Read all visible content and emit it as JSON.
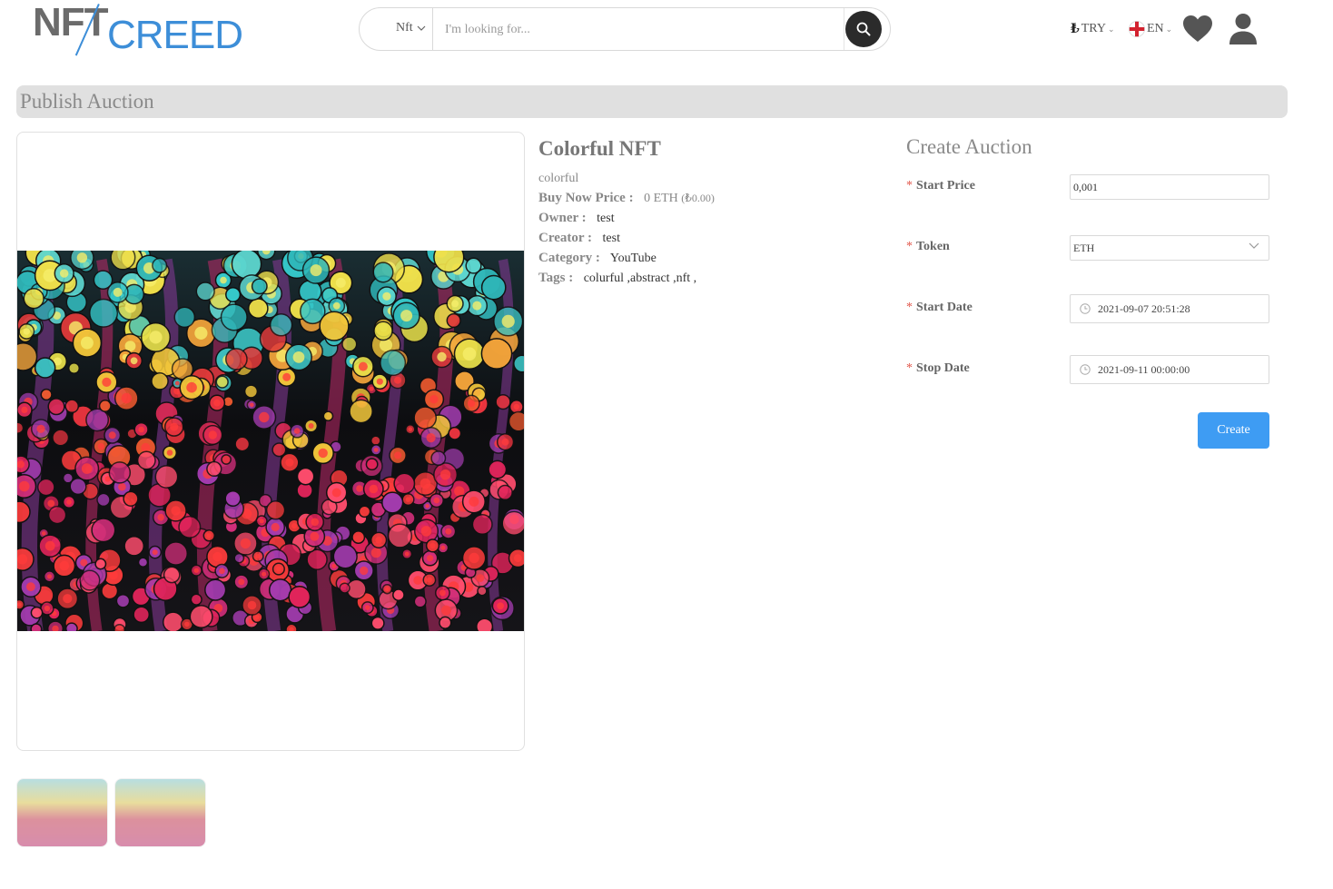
{
  "header": {
    "logo_part1": "NFT",
    "logo_part2": "CREED",
    "search": {
      "category": "Nft",
      "placeholder": "I'm looking for..."
    },
    "currency": "TRY",
    "currency_symbol": "₺",
    "language": "EN"
  },
  "page": {
    "title": "Publish Auction"
  },
  "nft": {
    "title": "Colorful NFT",
    "description": "colorful",
    "buy_now_label": "Buy Now Price :",
    "buy_now_value": "0 ETH",
    "buy_now_converted": "(₺0.00)",
    "owner_label": "Owner :",
    "owner_value": "test",
    "creator_label": "Creator :",
    "creator_value": "test",
    "category_label": "Category :",
    "category_value": "YouTube",
    "tags_label": "Tags :",
    "tags_value": "colurful ,abstract ,nft ,"
  },
  "form": {
    "title": "Create Auction",
    "start_price_label": "Start Price",
    "start_price_value": "0,001",
    "token_label": "Token",
    "token_value": "ETH",
    "start_date_label": "Start Date",
    "start_date_value": "2021-09-07 20:51:28",
    "stop_date_label": "Stop Date",
    "stop_date_value": "2021-09-11 00:00:00",
    "required_mark": "*",
    "create_label": "Create"
  },
  "colors": {
    "accent": "#3e9cf3",
    "logo_blue": "#3d8ed8",
    "title_bar": "#e0e0e0",
    "required": "#e2564a"
  },
  "icons": [
    "search-icon",
    "heart-icon",
    "user-icon",
    "flag-icon",
    "chevron-down-icon",
    "clock-icon"
  ]
}
